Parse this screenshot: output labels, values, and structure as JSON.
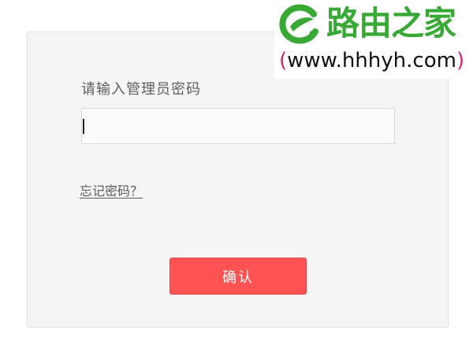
{
  "login": {
    "password_label": "请输入管理员密码",
    "password_value": "",
    "forgot_password": "忘记密码？",
    "confirm_button": "确认"
  },
  "watermark": {
    "brand": "路由之家",
    "url_open": "(",
    "url": "www.hhhyh.com",
    "url_close": ")",
    "colors": {
      "brand_green": "#39a935",
      "paren_pink": "#d6246e"
    }
  },
  "colors": {
    "card_bg": "#f5f5f5",
    "button_bg": "#ff5252",
    "label_text": "#5e5e5e"
  }
}
